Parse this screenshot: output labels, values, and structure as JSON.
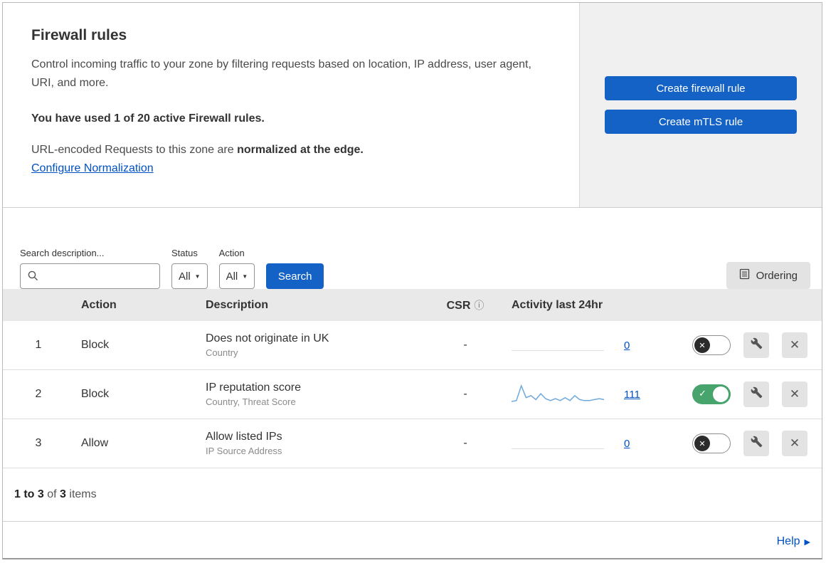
{
  "header": {
    "title": "Firewall rules",
    "description": "Control incoming traffic to your zone by filtering requests based on location, IP address, user agent, URI, and more.",
    "usage": "You have used 1 of 20 active Firewall rules.",
    "normalization_prefix": "URL-encoded Requests to this zone are ",
    "normalization_bold": "normalized at the edge.",
    "normalization_link": "Configure Normalization",
    "create_firewall_button": "Create firewall rule",
    "create_mtls_button": "Create mTLS rule"
  },
  "toolbar": {
    "search_label": "Search description...",
    "status_label": "Status",
    "status_value": "All",
    "action_label": "Action",
    "action_value": "All",
    "search_button": "Search",
    "ordering_button": "Ordering"
  },
  "table": {
    "columns": {
      "action": "Action",
      "description": "Description",
      "csr": "CSR",
      "activity": "Activity last 24hr"
    },
    "rows": [
      {
        "index": "1",
        "action": "Block",
        "description": "Does not originate in UK",
        "fields": "Country",
        "csr": "-",
        "count": "0",
        "enabled": false,
        "sparkline": []
      },
      {
        "index": "2",
        "action": "Block",
        "description": "IP reputation score",
        "fields": "Country, Threat Score",
        "csr": "-",
        "count": "111",
        "enabled": true,
        "sparkline": [
          2,
          3,
          18,
          6,
          8,
          4,
          10,
          5,
          3,
          5,
          3,
          6,
          3,
          8,
          4,
          3,
          3,
          4,
          5,
          4
        ]
      },
      {
        "index": "3",
        "action": "Allow",
        "description": "Allow listed IPs",
        "fields": "IP Source Address",
        "csr": "-",
        "count": "0",
        "enabled": false,
        "sparkline": []
      }
    ]
  },
  "footer": {
    "range": "1 to 3",
    "of": " of ",
    "total": "3",
    "items": " items"
  },
  "help": {
    "label": "Help"
  },
  "icons": {
    "caret": "▼",
    "check": "✓",
    "x": "✕",
    "info": "ⓘ",
    "help_arrow": "▶"
  },
  "colors": {
    "accent_blue": "#1562c6",
    "link_blue": "#0051c3",
    "toggle_green": "#46a46c",
    "sparkline_blue": "#6ea8dc"
  }
}
